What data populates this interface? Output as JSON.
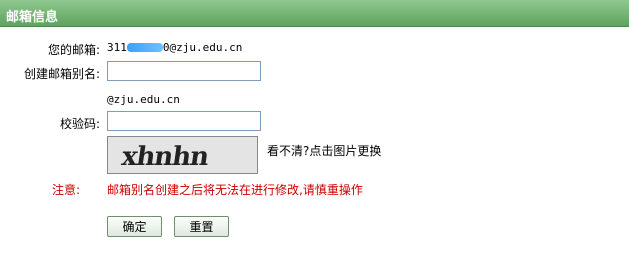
{
  "header": {
    "title": "邮箱信息"
  },
  "form": {
    "email_label": "您的邮箱:",
    "email_prefix": "311",
    "email_suffix": "0@zju.edu.cn",
    "alias_label": "创建邮箱别名:",
    "alias_value": "",
    "alias_domain": "@zju.edu.cn",
    "captcha_label": "校验码:",
    "captcha_value": "",
    "captcha_image_text": "xhnhn",
    "captcha_hint": "看不清?点击图片更换",
    "note_label": "注意:",
    "note_text": "邮箱别名创建之后将无法在进行修改,请慎重操作"
  },
  "buttons": {
    "ok": "确定",
    "reset": "重置"
  },
  "colors": {
    "header_bg": "#6fb06f",
    "warning": "#cc0000"
  }
}
